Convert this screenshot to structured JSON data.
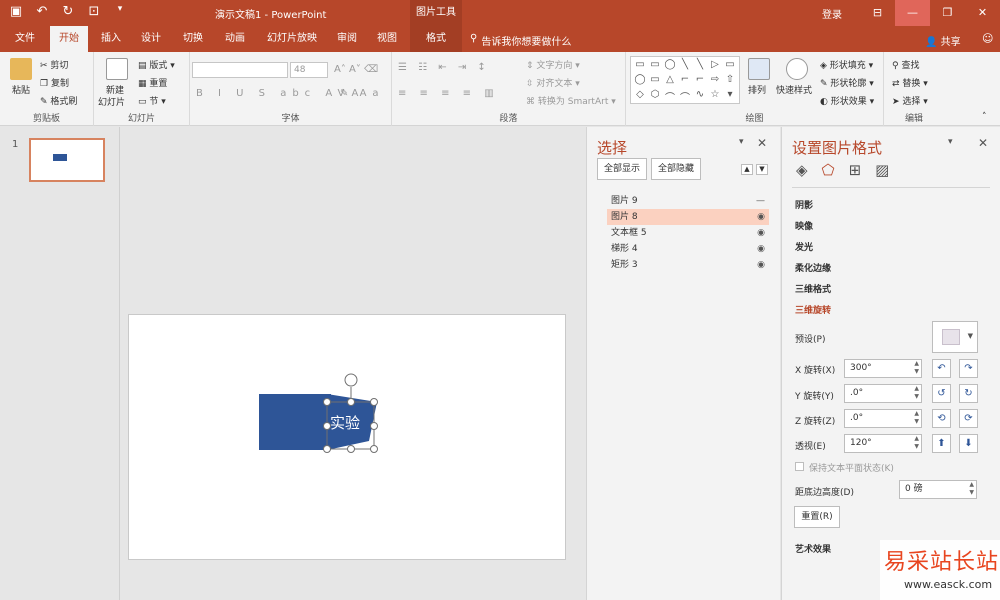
{
  "titlebar": {
    "title": "演示文稿1 - PowerPoint",
    "tools": "图片工具",
    "login": "登录",
    "qat_icons": [
      "save-icon",
      "undo-icon",
      "redo-icon",
      "start-slideshow-icon",
      "customize-qat-icon"
    ]
  },
  "tabs": {
    "items": [
      {
        "label": "文件"
      },
      {
        "label": "开始"
      },
      {
        "label": "插入"
      },
      {
        "label": "设计"
      },
      {
        "label": "切换"
      },
      {
        "label": "动画"
      },
      {
        "label": "幻灯片放映"
      },
      {
        "label": "审阅"
      },
      {
        "label": "视图"
      },
      {
        "label": "格式"
      }
    ],
    "active": "开始",
    "tell_me": "告诉我你想要做什么",
    "share": "共享"
  },
  "ribbon": {
    "clipboard": {
      "label": "剪贴板",
      "paste": "粘贴",
      "cut": "剪切",
      "copy": "复制",
      "format_painter": "格式刷"
    },
    "slides": {
      "label": "幻灯片",
      "new_slide": "新建",
      "new_slide2": "幻灯片",
      "layout": "版式",
      "reset": "重置",
      "section": "节"
    },
    "font": {
      "label": "字体",
      "size": "48"
    },
    "paragraph": {
      "label": "段落",
      "text_direction": "文字方向",
      "align_text": "对齐文本",
      "smartart": "转换为 SmartArt"
    },
    "drawing": {
      "label": "绘图",
      "arrange": "排列",
      "quick_styles": "快速样式",
      "shape_fill": "形状填充",
      "shape_outline": "形状轮廓",
      "shape_effects": "形状效果"
    },
    "editing": {
      "label": "编辑",
      "find": "查找",
      "replace": "替换",
      "select": "选择"
    }
  },
  "thumbnails": {
    "number": "1"
  },
  "selection_pane": {
    "title": "选择",
    "show_all": "全部显示",
    "hide_all": "全部隐藏",
    "items": [
      {
        "name": "图片 9",
        "visible": false,
        "selected": false
      },
      {
        "name": "图片 8",
        "visible": true,
        "selected": true
      },
      {
        "name": "文本框 5",
        "visible": true,
        "selected": false
      },
      {
        "name": "梯形 4",
        "visible": true,
        "selected": false
      },
      {
        "name": "矩形 3",
        "visible": true,
        "selected": false
      }
    ]
  },
  "format_pane": {
    "title": "设置图片格式",
    "sections": [
      "阴影",
      "映像",
      "发光",
      "柔化边缘",
      "三维格式",
      "三维旋转"
    ],
    "active_section": "三维旋转",
    "preset_label": "预设(P)",
    "x_rotation_label": "X 旋转(X)",
    "x_rotation_value": "300°",
    "y_rotation_label": "Y 旋转(Y)",
    "y_rotation_value": ".0°",
    "z_rotation_label": "Z 旋转(Z)",
    "z_rotation_value": ".0°",
    "perspective_label": "透视(E)",
    "perspective_value": "120°",
    "keep_flat_label": "保持文本平面状态(K)",
    "distance_label": "距底边高度(D)",
    "distance_value": "0 磅",
    "reset_label": "重置(R)",
    "artistic_label": "艺术效果"
  },
  "slide": {
    "text": "实验"
  },
  "watermark": {
    "text": "易采站长站",
    "url": "www.easck.com"
  },
  "colors": {
    "accent": "#b7472a",
    "shape_blue": "#2e5597",
    "selection": "#fbd1c0"
  }
}
